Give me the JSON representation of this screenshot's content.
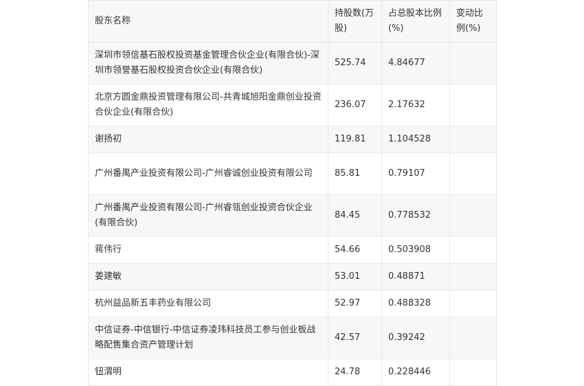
{
  "table": {
    "headers": [
      "股东名称",
      "持股数(万股)",
      "占总股本比例(%)",
      "变动比例(%)"
    ],
    "rows": [
      [
        "深圳市领信基石股权投资基金管理合伙企业(有限合伙)-深圳市领誉基石股权投资合伙企业(有限合伙)",
        "525.74",
        "4.84677",
        ""
      ],
      [
        "北京方圆金鼎投资管理有限公司-共青城旭阳金鼎创业投资合伙企业(有限合伙)",
        "236.07",
        "2.17632",
        ""
      ],
      [
        "谢扬初",
        "119.81",
        "1.104528",
        ""
      ],
      [
        "广州番禺产业投资有限公司-广州睿诚创业投资有限公司",
        "85.81",
        "0.79107",
        ""
      ],
      [
        "广州番禺产业投资有限公司-广州睿瓴创业投资合伙企业(有限合伙)",
        "84.45",
        "0.778532",
        ""
      ],
      [
        "蒋伟行",
        "54.66",
        "0.503908",
        ""
      ],
      [
        "姜建敏",
        "53.01",
        "0.48871",
        ""
      ],
      [
        "杭州益品新五丰药业有限公司",
        "52.97",
        "0.488328",
        ""
      ],
      [
        "中信证券-中信银行-中信证券凌玮科技员工参与创业板战略配售集合资产管理计划",
        "42.57",
        "0.39242",
        ""
      ],
      [
        "钮渭明",
        "24.78",
        "0.228446",
        ""
      ]
    ]
  }
}
